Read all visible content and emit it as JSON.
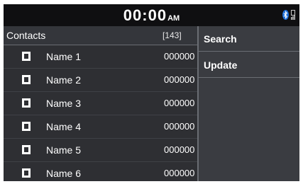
{
  "status_bar": {
    "time": "00:00",
    "ampm": "AM",
    "icons": [
      "bluetooth-icon",
      "phone-signal-icon"
    ]
  },
  "contacts": {
    "title": "Contacts",
    "count": "[143]",
    "items": [
      {
        "name": "Name 1",
        "number": "000000"
      },
      {
        "name": "Name 2",
        "number": "000000"
      },
      {
        "name": "Name 3",
        "number": "000000"
      },
      {
        "name": "Name 4",
        "number": "000000"
      },
      {
        "name": "Name 5",
        "number": "000000"
      },
      {
        "name": "Name 6",
        "number": "000000"
      }
    ]
  },
  "menu": {
    "items": [
      {
        "label": "Search"
      },
      {
        "label": "Update"
      }
    ]
  },
  "colors": {
    "background": "#2e2f33",
    "top_bar": "#0f0f11",
    "menu_background": "#3a3c41",
    "divider": "#6a6d73",
    "bluetooth": "#1e6fd9"
  }
}
